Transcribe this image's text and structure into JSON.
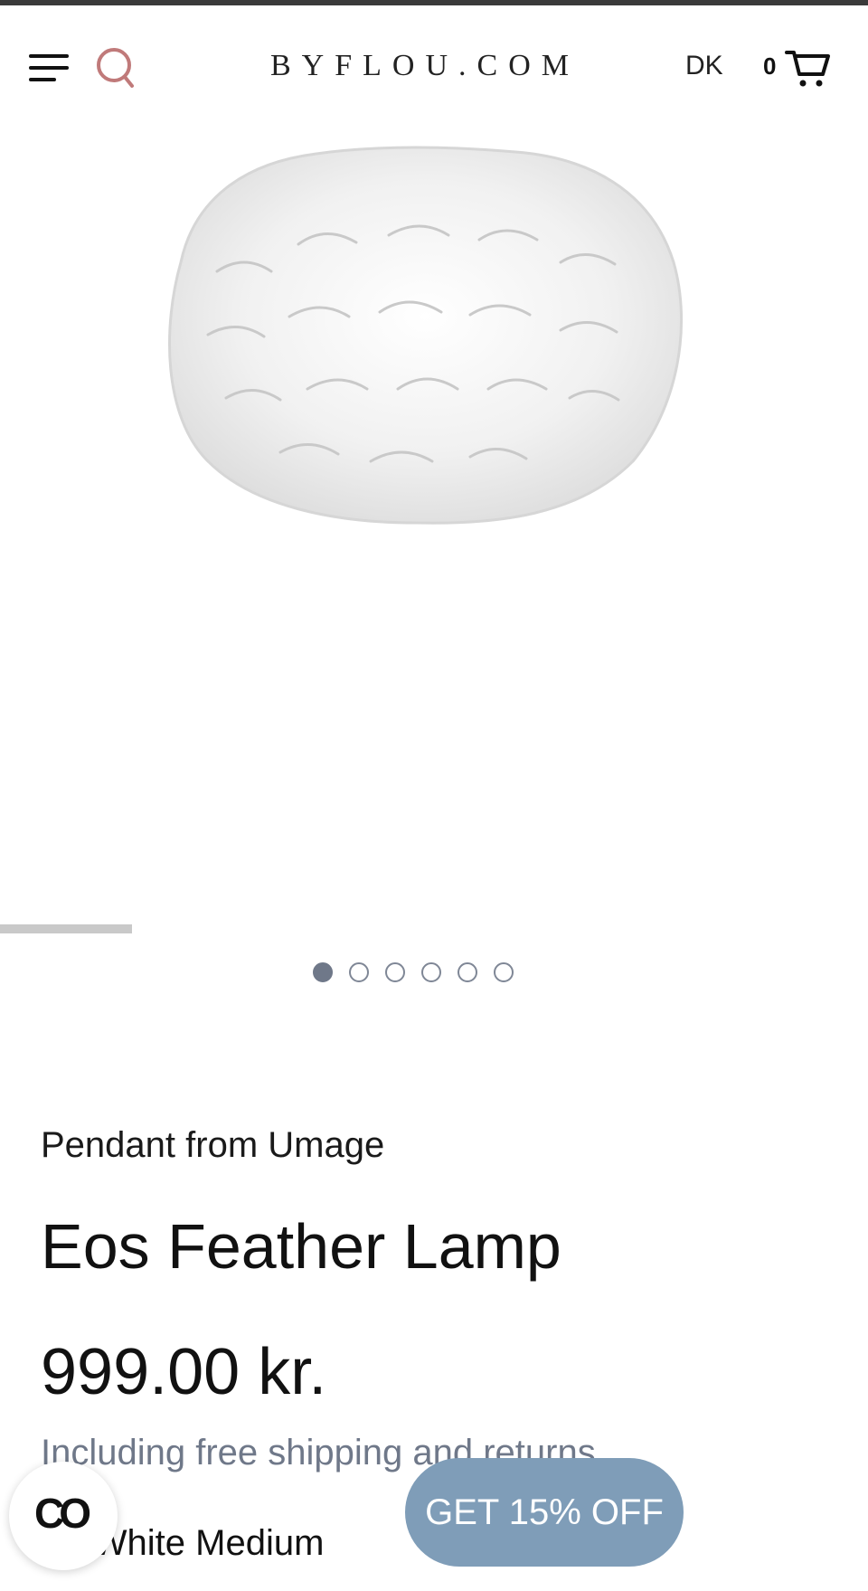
{
  "header": {
    "menu_icon": "hamburger-menu-icon",
    "search_icon": "search-icon",
    "logo": "BYFLOU.COM",
    "language": "DK",
    "cart_count": "0",
    "cart_icon": "shopping-cart-icon",
    "search_color": "#c07a7a"
  },
  "gallery": {
    "image_alt": "Eos Feather Lamp",
    "dots_total": 6,
    "active_dot": 0
  },
  "product": {
    "subtitle": "Pendant from Umage",
    "title": "Eos Feather Lamp",
    "price": "999.00 kr.",
    "shipping_note": "Including free shipping and returns",
    "color_line": "or: White Medium"
  },
  "chat": {
    "icon": "chat-widget-icon",
    "glyph": "CO"
  },
  "promo": {
    "label": "GET 15% OFF",
    "color": "#7f9db8"
  }
}
